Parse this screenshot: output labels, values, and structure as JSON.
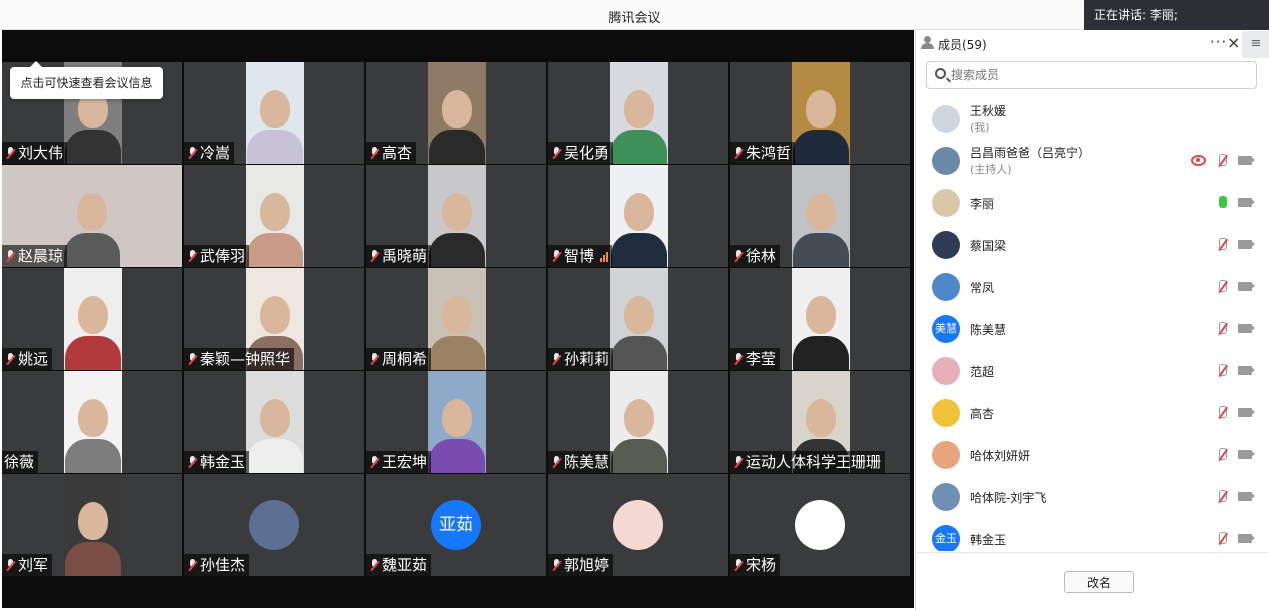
{
  "app": {
    "title": "腾讯会议"
  },
  "speaking": {
    "label": "正在讲话: 李丽;"
  },
  "tooltip": {
    "text": "点击可快速查看会议信息"
  },
  "grid": {
    "tiles": [
      {
        "name": "刘大伟",
        "kind": "cam",
        "bg": "#7f7f7f",
        "shirt": "#333333"
      },
      {
        "name": "冷嵩",
        "kind": "cam",
        "bg": "#dfe6ec",
        "shirt": "#c7c2d6"
      },
      {
        "name": "高杏",
        "kind": "cam",
        "bg": "#8f7a66",
        "shirt": "#2a2a2a"
      },
      {
        "name": "吴化勇",
        "kind": "cam",
        "bg": "#d6dadf",
        "shirt": "#3f8f5a"
      },
      {
        "name": "朱鸿哲",
        "kind": "cam",
        "bg": "#b58a43",
        "shirt": "#1f2a3a"
      },
      {
        "name": "赵晨琼",
        "kind": "wide",
        "bg": "#cfc7c4",
        "shirt": "#5b5b5b"
      },
      {
        "name": "武俸羽",
        "kind": "cam",
        "bg": "#e8e8e6",
        "shirt": "#c79b86"
      },
      {
        "name": "禹晓萌",
        "kind": "cam",
        "bg": "#c8c8ca",
        "shirt": "#2a2a2a"
      },
      {
        "name": "智博",
        "kind": "cam",
        "bg": "#eef0f2",
        "shirt": "#1f2c3d",
        "signal": true
      },
      {
        "name": "徐林",
        "kind": "cam",
        "bg": "#bfc3c6",
        "shirt": "#444c55"
      },
      {
        "name": "姚远",
        "kind": "cam",
        "bg": "#eeeeee",
        "shirt": "#b33a3a"
      },
      {
        "name": "秦颖—钟照华",
        "kind": "cam",
        "bg": "#ede7e0",
        "shirt": "#8a6f67"
      },
      {
        "name": "周桐希",
        "kind": "cam",
        "bg": "#c9c1b6",
        "shirt": "#9b8163"
      },
      {
        "name": "孙莉莉",
        "kind": "cam",
        "bg": "#d0d2d4",
        "shirt": "#555555"
      },
      {
        "name": "李莹",
        "kind": "cam",
        "bg": "#efefef",
        "shirt": "#222222"
      },
      {
        "name": "徐薇",
        "kind": "cam",
        "bg": "#f3f3f3",
        "shirt": "#7d7d7d",
        "nomic": true
      },
      {
        "name": "韩金玉",
        "kind": "cam",
        "bg": "#dcdcdc",
        "shirt": "#eeeeee"
      },
      {
        "name": "王宏坤",
        "kind": "cam",
        "bg": "#8fa9c8",
        "shirt": "#7b4cb0"
      },
      {
        "name": "陈美慧",
        "kind": "cam",
        "bg": "#ececec",
        "shirt": "#565c52"
      },
      {
        "name": "运动人体科学王珊珊",
        "kind": "cam",
        "bg": "#d9d4cb",
        "shirt": "#333333"
      },
      {
        "name": "刘军",
        "kind": "cam",
        "bg": "#3a3a3a",
        "shirt": "#7a4e45"
      },
      {
        "name": "孙佳杰",
        "kind": "avatar",
        "avatarColor": "#5d6f93"
      },
      {
        "name": "魏亚茹",
        "kind": "avatar-text",
        "avatarText": "亚茹"
      },
      {
        "name": "郭旭婷",
        "kind": "avatar",
        "avatarColor": "#f4d9d2"
      },
      {
        "name": "宋杨",
        "kind": "avatar",
        "avatarColor": "#ffffff"
      }
    ]
  },
  "panel": {
    "title": "成员(59)",
    "more": "···",
    "close": "×",
    "menu": "≡",
    "search_placeholder": "搜索成员",
    "members": [
      {
        "name": "王秋媛",
        "sub": "(我)",
        "avatarColor": "#cfd6de",
        "mic": "none",
        "cam": false
      },
      {
        "name": "吕昌雨爸爸（吕亮宁）",
        "sub": "(主持人)",
        "avatarColor": "#6b89a8",
        "mic": "off",
        "cam": true,
        "eye": true
      },
      {
        "name": "李丽",
        "avatarColor": "#d9c8a8",
        "mic": "on",
        "cam": true
      },
      {
        "name": "蔡国梁",
        "avatarColor": "#2f3a55",
        "mic": "off",
        "cam": true
      },
      {
        "name": "常凤",
        "avatarColor": "#4f88c8",
        "mic": "off",
        "cam": true
      },
      {
        "name": "陈美慧",
        "avatarText": "美慧",
        "mic": "off",
        "cam": true
      },
      {
        "name": "范超",
        "avatarColor": "#e7b0b8",
        "mic": "off",
        "cam": true
      },
      {
        "name": "高杏",
        "avatarColor": "#f0c23a",
        "mic": "off",
        "cam": true
      },
      {
        "name": "哈体刘妍妍",
        "avatarColor": "#e6a57c",
        "mic": "off",
        "cam": true
      },
      {
        "name": "哈体院-刘宇飞",
        "avatarColor": "#6f8fb4",
        "mic": "off",
        "cam": true
      },
      {
        "name": "韩金玉",
        "avatarText": "金玉",
        "mic": "off",
        "cam": true
      }
    ],
    "rename_label": "改名"
  }
}
